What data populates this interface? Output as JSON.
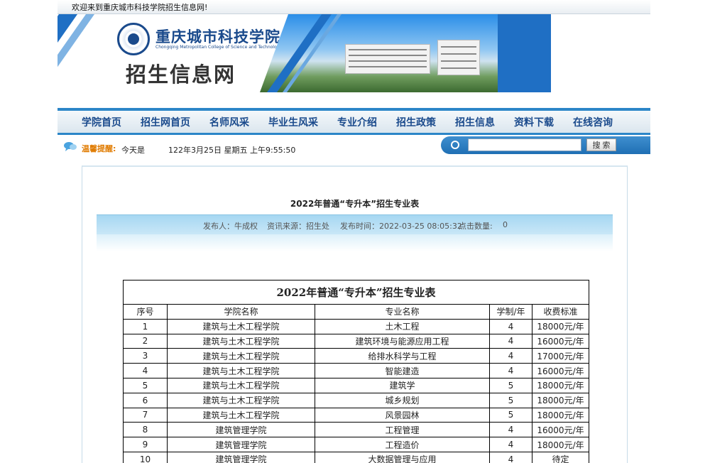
{
  "welcome": "欢迎来到重庆城市科技学院招生信息网!",
  "banner": {
    "school_cn": "重庆城市科技学院",
    "school_en": "Chongqing Metropolitan College of Science and Technology",
    "site_title": "招生信息网"
  },
  "nav": [
    "学院首页",
    "招生网首页",
    "名师风采",
    "毕业生风采",
    "专业介绍",
    "招生政策",
    "招生信息",
    "资料下载",
    "在线咨询"
  ],
  "info": {
    "notice_label": "温馨提醒:",
    "today_label": "今天是",
    "datetime": "122年3月25日 星期五 上午9:55:50"
  },
  "search": {
    "value": "",
    "button": "搜 索"
  },
  "article": {
    "title": "2022年普通“专升本”招生专业表",
    "publisher": "发布人：牛成权",
    "source": "资讯来源：招生处",
    "time": "发布时间：2022-03-25 08:05:32",
    "views_label": "点击数量:",
    "views": "0"
  },
  "table": {
    "caption": "2022年普通“专升本”招生专业表",
    "headers": [
      "序号",
      "学院名称",
      "专业名称",
      "学制/年",
      "收费标准"
    ],
    "rows": [
      [
        "1",
        "建筑与土木工程学院",
        "土木工程",
        "4",
        "18000元/年"
      ],
      [
        "2",
        "建筑与土木工程学院",
        "建筑环境与能源应用工程",
        "4",
        "16000元/年"
      ],
      [
        "3",
        "建筑与土木工程学院",
        "给排水科学与工程",
        "4",
        "17000元/年"
      ],
      [
        "4",
        "建筑与土木工程学院",
        "智能建造",
        "4",
        "16000元/年"
      ],
      [
        "5",
        "建筑与土木工程学院",
        "建筑学",
        "5",
        "18000元/年"
      ],
      [
        "6",
        "建筑与土木工程学院",
        "城乡规划",
        "5",
        "18000元/年"
      ],
      [
        "7",
        "建筑与土木工程学院",
        "风景园林",
        "5",
        "18000元/年"
      ],
      [
        "8",
        "建筑管理学院",
        "工程管理",
        "4",
        "16000元/年"
      ],
      [
        "9",
        "建筑管理学院",
        "工程造价",
        "4",
        "18000元/年"
      ],
      [
        "10",
        "建筑管理学院",
        "大数据管理与应用",
        "4",
        "待定"
      ]
    ]
  }
}
